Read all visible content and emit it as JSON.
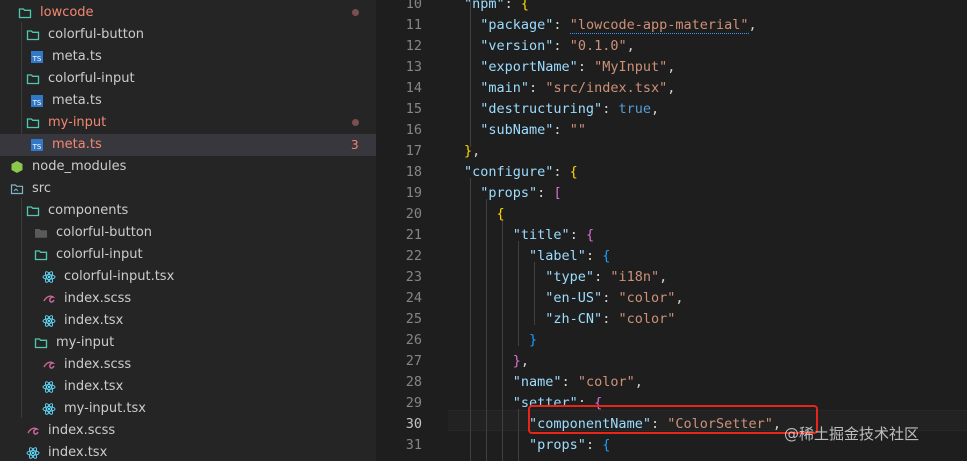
{
  "explorer": {
    "items": [
      {
        "label": "lowcode",
        "kind": "folder-open",
        "modified": true
      },
      {
        "label": "colorful-button",
        "kind": "folder-open"
      },
      {
        "label": "meta.ts",
        "kind": "ts"
      },
      {
        "label": "colorful-input",
        "kind": "folder-open"
      },
      {
        "label": "meta.ts",
        "kind": "ts"
      },
      {
        "label": "my-input",
        "kind": "folder-open",
        "modified": true
      },
      {
        "label": "meta.ts",
        "kind": "ts",
        "badge": "3",
        "selected": true
      },
      {
        "label": "node_modules",
        "kind": "node"
      },
      {
        "label": "src",
        "kind": "src"
      },
      {
        "label": "components",
        "kind": "folder-open"
      },
      {
        "label": "colorful-button",
        "kind": "folder-closed"
      },
      {
        "label": "colorful-input",
        "kind": "folder-open"
      },
      {
        "label": "colorful-input.tsx",
        "kind": "react"
      },
      {
        "label": "index.scss",
        "kind": "sass"
      },
      {
        "label": "index.tsx",
        "kind": "react"
      },
      {
        "label": "my-input",
        "kind": "folder-open"
      },
      {
        "label": "index.scss",
        "kind": "sass"
      },
      {
        "label": "index.tsx",
        "kind": "react"
      },
      {
        "label": "my-input.tsx",
        "kind": "react"
      },
      {
        "label": "index.scss",
        "kind": "sass"
      },
      {
        "label": "index.tsx",
        "kind": "react"
      }
    ]
  },
  "editor": {
    "line_numbers": [
      "10",
      "11",
      "12",
      "13",
      "14",
      "15",
      "16",
      "17",
      "18",
      "19",
      "20",
      "21",
      "22",
      "23",
      "24",
      "25",
      "26",
      "27",
      "28",
      "29",
      "30",
      "31"
    ],
    "active_line": "30",
    "tokens": {
      "l10_key": "\"npm\"",
      "l11_key": "\"package\"",
      "l11_val": "\"lowcode-app-material\"",
      "l12_key": "\"version\"",
      "l12_val": "\"0.1.0\"",
      "l13_key": "\"exportName\"",
      "l13_val": "\"MyInput\"",
      "l14_key": "\"main\"",
      "l14_val": "\"src/index.tsx\"",
      "l15_key": "\"destructuring\"",
      "l15_val": "true",
      "l16_key": "\"subName\"",
      "l16_val": "\"\"",
      "l18_key": "\"configure\"",
      "l19_key": "\"props\"",
      "l21_key": "\"title\"",
      "l22_key": "\"label\"",
      "l23_key": "\"type\"",
      "l23_val": "\"i18n\"",
      "l24_key": "\"en-US\"",
      "l24_val": "\"color\"",
      "l25_key": "\"zh-CN\"",
      "l25_val": "\"color\"",
      "l28_key": "\"name\"",
      "l28_val": "\"color\"",
      "l29_key": "\"setter\"",
      "l30_key": "\"componentName\"",
      "l30_val": "\"ColorSetter\"",
      "l31_key": "\"props\""
    }
  },
  "watermark": "@稀土掘金技术社区",
  "colors": {
    "accent_red": "#e8251a",
    "modified": "#f48771"
  }
}
